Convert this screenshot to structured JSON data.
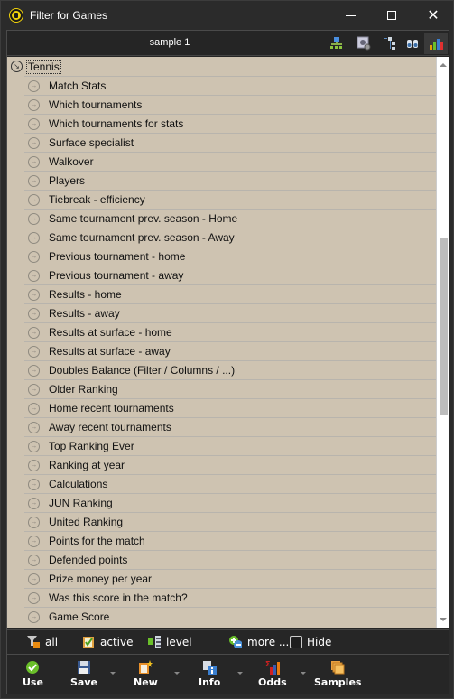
{
  "window": {
    "title": "Filter for Games",
    "controls": {
      "minimize": "minimize",
      "maximize": "maximize",
      "close": "close"
    }
  },
  "header": {
    "title": "sample 1",
    "buttons": [
      {
        "name": "hierarchy-icon",
        "tooltip": ""
      },
      {
        "name": "settings-icon",
        "tooltip": ""
      },
      {
        "name": "tree-icon",
        "tooltip": ""
      },
      {
        "name": "binoculars-icon",
        "tooltip": ""
      },
      {
        "name": "bar-chart-icon",
        "tooltip": "",
        "active": true
      }
    ]
  },
  "tree": {
    "root": {
      "label": "Tennis",
      "icon": "collapse-arrow-icon"
    },
    "items": [
      "Match Stats",
      "Which tournaments",
      "Which tournaments for stats",
      "Surface specialist",
      "Walkover",
      "Players",
      "Tiebreak - efficiency",
      "Same tournament prev. season - Home",
      "Same tournament prev. season - Away",
      "Previous tournament - home",
      "Previous tournament - away",
      "Results - home",
      "Results - away",
      "Results at surface - home",
      "Results at surface - away",
      "Doubles Balance (Filter / Columns / ...)",
      "Older Ranking",
      "Home recent tournaments",
      "Away recent tournaments",
      "Top Ranking Ever",
      "Ranking at year",
      "Calculations",
      "JUN Ranking",
      "United Ranking",
      "Points for the match",
      "Defended points",
      "Prize money per year",
      "Was this score in the match?",
      "Game Score"
    ]
  },
  "filterbar": {
    "all": "all",
    "active": "active",
    "level": "level",
    "more": "more ...",
    "hide": "Hide",
    "hide_checked": false
  },
  "toolbar": {
    "use": "Use",
    "save": "Save",
    "new": "New",
    "info": "Info",
    "odds": "Odds",
    "samples": "Samples"
  },
  "colors": {
    "list_bg": "#cec3b1",
    "chrome_bg": "#2b2b2b",
    "accent_green": "#6abf2a"
  }
}
